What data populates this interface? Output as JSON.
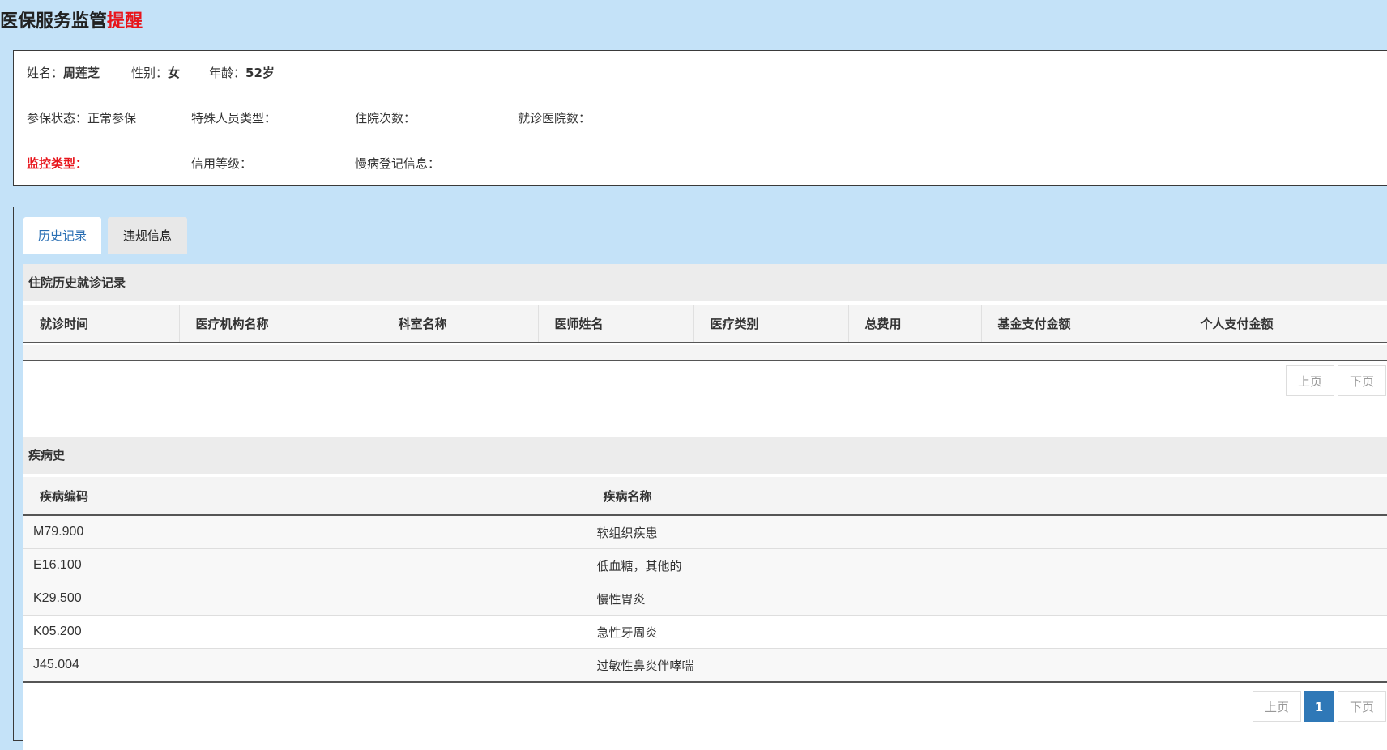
{
  "header": {
    "title_main": "医保服务监管",
    "title_highlight": "提醒"
  },
  "patient": {
    "name_label": "姓名：",
    "name": "周莲芝",
    "gender_label": "性别：",
    "gender": "女",
    "age_label": "年龄：",
    "age": "52岁",
    "insurance_status": "参保状态：正常参保",
    "special_type": "特殊人员类型：",
    "hospitalization_count": "住院次数：",
    "hospital_visits": "就诊医院数：",
    "monitor_type": "监控类型：",
    "credit_level": "信用等级：",
    "chronic_info": "慢病登记信息："
  },
  "tabs": [
    {
      "label": "历史记录"
    },
    {
      "label": "违规信息"
    }
  ],
  "history": {
    "section_title": "住院历史就诊记录",
    "columns": [
      "就诊时间",
      "医疗机构名称",
      "科室名称",
      "医师姓名",
      "医疗类别",
      "总费用",
      "基金支付金额",
      "个人支付金额"
    ],
    "pager": {
      "prev": "上页",
      "next": "下页"
    }
  },
  "disease": {
    "section_title": "疾病史",
    "columns": [
      "疾病编码",
      "疾病名称"
    ],
    "rows": [
      {
        "code": "M79.900",
        "name": "软组织疾患"
      },
      {
        "code": "E16.100",
        "name": "低血糖，其他的"
      },
      {
        "code": "K29.500",
        "name": "慢性胃炎"
      },
      {
        "code": "K05.200",
        "name": "急性牙周炎"
      },
      {
        "code": "J45.004",
        "name": "过敏性鼻炎伴哮喘"
      }
    ],
    "pager": {
      "prev": "上页",
      "current": "1",
      "next": "下页"
    }
  },
  "colors": {
    "highlight": "#e8141b",
    "accent": "#2f78b7",
    "background": "#c4e2f8"
  }
}
